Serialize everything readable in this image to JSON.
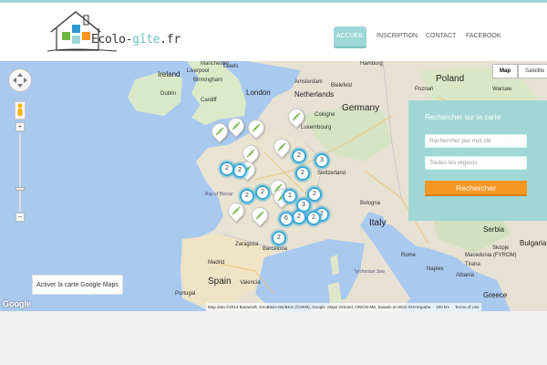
{
  "header": {
    "logo_text_main": "Ecolo-",
    "logo_text_accent": "gîte",
    "logo_text_tld": ".fr",
    "nav": [
      {
        "label": "Accueil",
        "active": true
      },
      {
        "label": "Inscription",
        "active": false
      },
      {
        "label": "Contact",
        "active": false
      },
      {
        "label": "Facebook",
        "active": false
      }
    ]
  },
  "map": {
    "type_buttons": [
      "Map",
      "Satellite"
    ],
    "labels": {
      "ireland": "Ireland",
      "uk_manchester": "Manchester",
      "liverpool": "Liverpool",
      "leeds": "Leeds",
      "birmingham": "Birmingham",
      "london": "London",
      "cardiff": "Cardiff",
      "dublin": "Dublin",
      "netherlands": "Netherlands",
      "amsterdam": "Amsterdam",
      "hamburg": "Hamburg",
      "bielefeld": "Bielefeld",
      "germany": "Germany",
      "cologne": "Cologne",
      "luxembourg": "Luxembourg",
      "poland": "Poland",
      "poznan": "Poznań",
      "warsaw": "Warsaw",
      "switzerland": "Switzerland",
      "bay_of_biscay": "Bay of Biscay",
      "italy": "Italy",
      "rome": "Rome",
      "naples": "Naples",
      "spain": "Spain",
      "madrid": "Madrid",
      "barcelona": "Barcelona",
      "zaragoza": "Zaragoza",
      "valencia": "Valencia",
      "portugal": "Portugal",
      "tyrrhenian": "Tyrrhenian Sea",
      "greece": "Greece",
      "serbia": "Serbia",
      "bulgaria": "Bulgaria",
      "albania": "Albania",
      "skopje": "Skopje",
      "tirana": "Tirana",
      "bologna": "Bologna",
      "macedonia": "Macedonia (FYROM)"
    },
    "clusters": [
      {
        "count": "3"
      },
      {
        "count": "2"
      },
      {
        "count": "2"
      },
      {
        "count": "2"
      },
      {
        "count": "2"
      },
      {
        "count": "2"
      },
      {
        "count": "2"
      },
      {
        "count": "3"
      },
      {
        "count": "2"
      },
      {
        "count": "2"
      },
      {
        "count": "6"
      },
      {
        "count": "2"
      },
      {
        "count": "2"
      },
      {
        "count": "1"
      },
      {
        "count": "2"
      }
    ],
    "activate_label": "Activer la carte Google Maps",
    "google_label": "Google",
    "attribution": "Map data ©2014 Basarsoft, GeoBasis-DE/BKG (©2009), Google, Maps GISrael, ORION-ME, basado en BCN IGN España",
    "scale": "200 km",
    "terms": "Terms of Use"
  },
  "search": {
    "title": "Rechercher sur la carte",
    "keyword_placeholder": "Rechercher par mot clé",
    "region_placeholder": "Toutes les régions",
    "button_label": "Rechercher",
    "accent_color": "#9ed7d7",
    "button_color": "#f7941d"
  }
}
